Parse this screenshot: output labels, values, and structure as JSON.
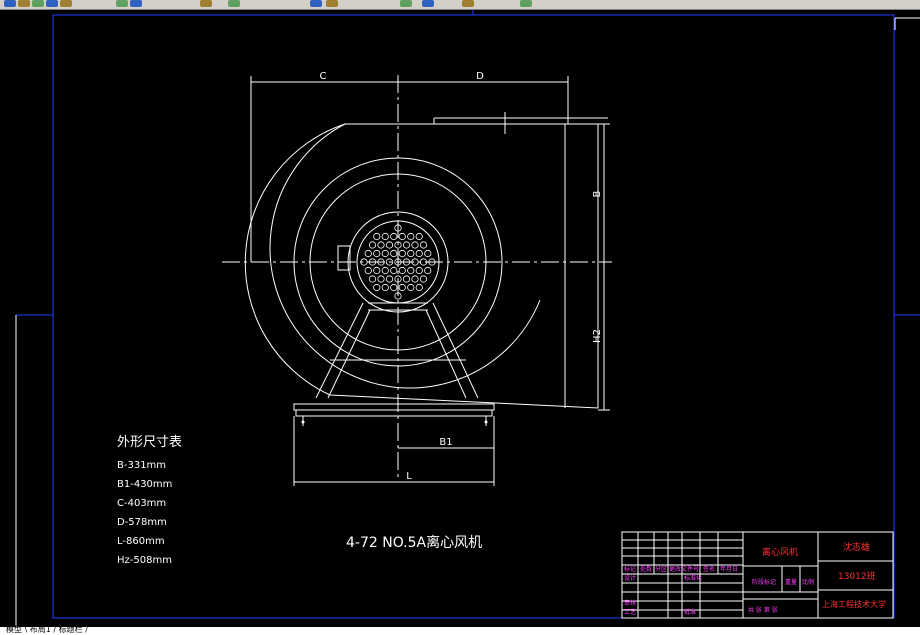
{
  "toolbar": {
    "buttons": [
      "undo-icon",
      "redo-icon",
      "pan-icon",
      "zoom-icon",
      "zoom-window-icon",
      "properties-icon",
      "layer-icon",
      "match-icon",
      "dimension-icon",
      "zoom-prev-icon",
      "grid-icon",
      "snap-icon",
      "ortho-icon",
      "table-icon",
      "help-icon"
    ]
  },
  "drawing": {
    "dims": {
      "c": "C",
      "d": "D",
      "b": "B",
      "h2": "H2",
      "b1": "B1",
      "l": "L"
    },
    "table_title": "外形尺寸表",
    "dimension_table": [
      "B-331mm",
      "B1-430mm",
      "C-403mm",
      "D-578mm",
      "L-860mm",
      "Hz-508mm"
    ],
    "caption": "4-72 NO.5A离心风机",
    "title_block": {
      "part_name": "离心风机",
      "owner": "沈志雄",
      "code": "13012班",
      "school": "上海工程技术大学",
      "header_cells": [
        "标记",
        "处数",
        "分区",
        "更改文件号",
        "签名",
        "年月日"
      ],
      "row2": {
        "design": "设计",
        "standard": "标准化",
        "stage": "阶段标记",
        "weight": "重量",
        "scale": "比例"
      },
      "row3": {
        "review": "审核",
        "process": "工艺",
        "approve": "批准",
        "sheets": "共 张 第 张"
      }
    },
    "colors": {
      "line": "#ffffff",
      "frame": "#2040ff",
      "title_text": "#ff3030",
      "table_text": "#ff40ff",
      "centerline": "#ffffff"
    }
  },
  "statusbar": {
    "text": "模型 \\ 布局1 / 标题栏 /"
  }
}
